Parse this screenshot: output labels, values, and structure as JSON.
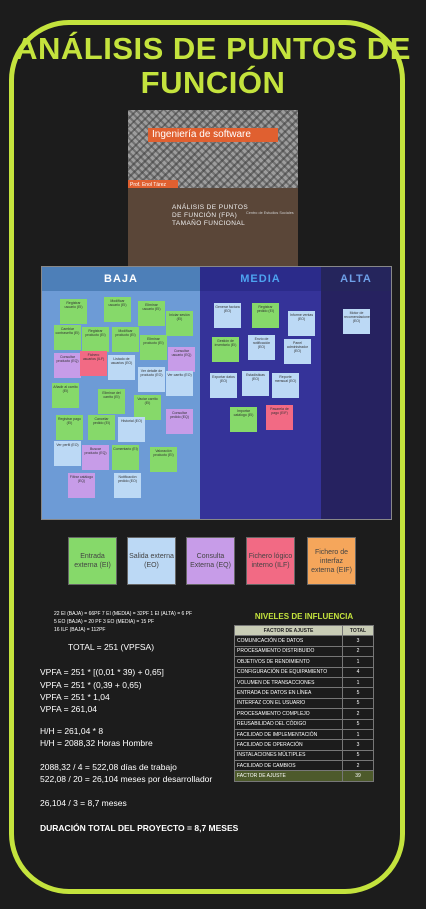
{
  "title": "ANÁLISIS DE PUNTOS DE FUNCIÓN",
  "book": {
    "tag": "Ingeniería de software",
    "author": "Prof. Enol Tárez",
    "subtitle": "ANÁLISIS DE PUNTOS DE FUNCIÓN (FPA) TAMAÑO FUNCIONAL",
    "publisher": "Centro de Estudios Sociales"
  },
  "board": {
    "columns": [
      {
        "label": "BAJA",
        "color": "#4a7fb5"
      },
      {
        "label": "MEDIA",
        "color": "#2d2d8c"
      },
      {
        "label": "ALTA",
        "color": "#25255c"
      }
    ],
    "baja_notes": [
      "Registrar usuario (EI)",
      "Modificar usuario (EI)",
      "Eliminar usuario (EI)",
      "Iniciar sesión (EI)",
      "Cambiar contraseña (EI)",
      "Registrar producto (EI)",
      "Modificar producto (EI)",
      "Eliminar producto (EI)",
      "Consultar usuario (EQ)",
      "Consultar producto (EQ)",
      "Fichero usuarios (ILF)",
      "Listado de usuarios (EO)",
      "Ver detalle de producto (EO)",
      "Ver carrito (EO)",
      "Añadir al carrito (EI)",
      "Eliminar del carrito (EI)",
      "Vaciar carrito (EI)",
      "Consultar pedido (EQ)",
      "Registrar pago (EI)",
      "Cancelar pedido (EI)",
      "Historial (EO)",
      "Ver perfil (EO)",
      "Buscar producto (EQ)",
      "Comentario (EI)",
      "Valoración producto (EI)",
      "Filtrar catálogo (EQ)",
      "Notificación pedido (EO)"
    ],
    "media_notes": [
      "Generar factura (EO)",
      "Registrar pedido (EI)",
      "Informe ventas (EO)",
      "Gestión de inventario (EI)",
      "Envío de notificación (EO)",
      "Panel administrador (EO)",
      "Exportar datos (EO)",
      "Estadísticas (EO)",
      "Reporte mensual (EO)",
      "Importar catálogo (EI)",
      "Pasarela de pago (EIF)"
    ],
    "alta_notes": [
      "Motor de recomendaciones (EO)"
    ]
  },
  "legend": [
    {
      "label": "Entrada externa (EI)",
      "color": "#86d96a"
    },
    {
      "label": "Salida externa (EO)",
      "color": "#bcd9f5"
    },
    {
      "label": "Consulta Externa (EQ)",
      "color": "#c79ce8"
    },
    {
      "label": "Fichero lógico interno (ILF)",
      "color": "#f26a84"
    },
    {
      "label": "Fichero de interfaz externa (EIF)",
      "color": "#f5a65b"
    }
  ],
  "counts": {
    "line1": "22 EI (BAJA) = 66PF   7 EI (MEDIA) = 32PF   1 EI (ALTA) = 6 PF",
    "line2": "5 EO (BAJA) = 20 PF   3 EO (MEDIA) = 15 PF",
    "line3": "16 ILF (BAJA) = 112PF"
  },
  "total": "TOTAL = 251  (VPFSA)",
  "vpfa": [
    "VPFA = 251 * [(0,01 * 39) + 0,65]",
    "VPFA = 251 * (0,39 + 0,65)",
    "VPFA = 251 * 1,04",
    "VPFA = 261,04"
  ],
  "hh": [
    "H/H = 261,04 * 8",
    "H/H = 2088,32 Horas Hombre"
  ],
  "days": [
    "2088,32 / 4 = 522,08 días de trabajo",
    "522,08 / 20 = 26,104 meses por desarrollador"
  ],
  "months": "26,104 / 3 = 8,7 meses",
  "duration": "DURACIÓN TOTAL DEL PROYECTO = 8,7 MESES",
  "influence": {
    "title": "NIVELES DE INFLUENCIA",
    "headers": [
      "FACTOR DE AJUSTE",
      "TOTAL"
    ],
    "rows": [
      [
        "COMUNICACIÓN DE DATOS",
        "3"
      ],
      [
        "PROCESAMIENTO DISTRIBUIDO",
        "2"
      ],
      [
        "OBJETIVOS DE RENDIMIENTO",
        "1"
      ],
      [
        "CONFIGURACIÓN DE EQUIPAMIENTO",
        "4"
      ],
      [
        "VOLUMEN DE TRANSACCIONES",
        "1"
      ],
      [
        "ENTRADA DE DATOS EN LÍNEA",
        "5"
      ],
      [
        "INTERFAZ CON EL USUARIO",
        "5"
      ],
      [
        "PROCESAMIENTO COMPLEJO",
        "2"
      ],
      [
        "REUSABILIDAD DEL CÓDIGO",
        "5"
      ],
      [
        "FACILIDAD DE IMPLEMENTACIÓN",
        "1"
      ],
      [
        "FACILIDAD DE OPERACIÓN",
        "3"
      ],
      [
        "INSTALACIONES MÚLTIPLES",
        "5"
      ],
      [
        "FACILIDAD DE CAMBIOS",
        "2"
      ]
    ],
    "total_label": "FACTOR DE AJUSTE",
    "total_value": "39"
  }
}
